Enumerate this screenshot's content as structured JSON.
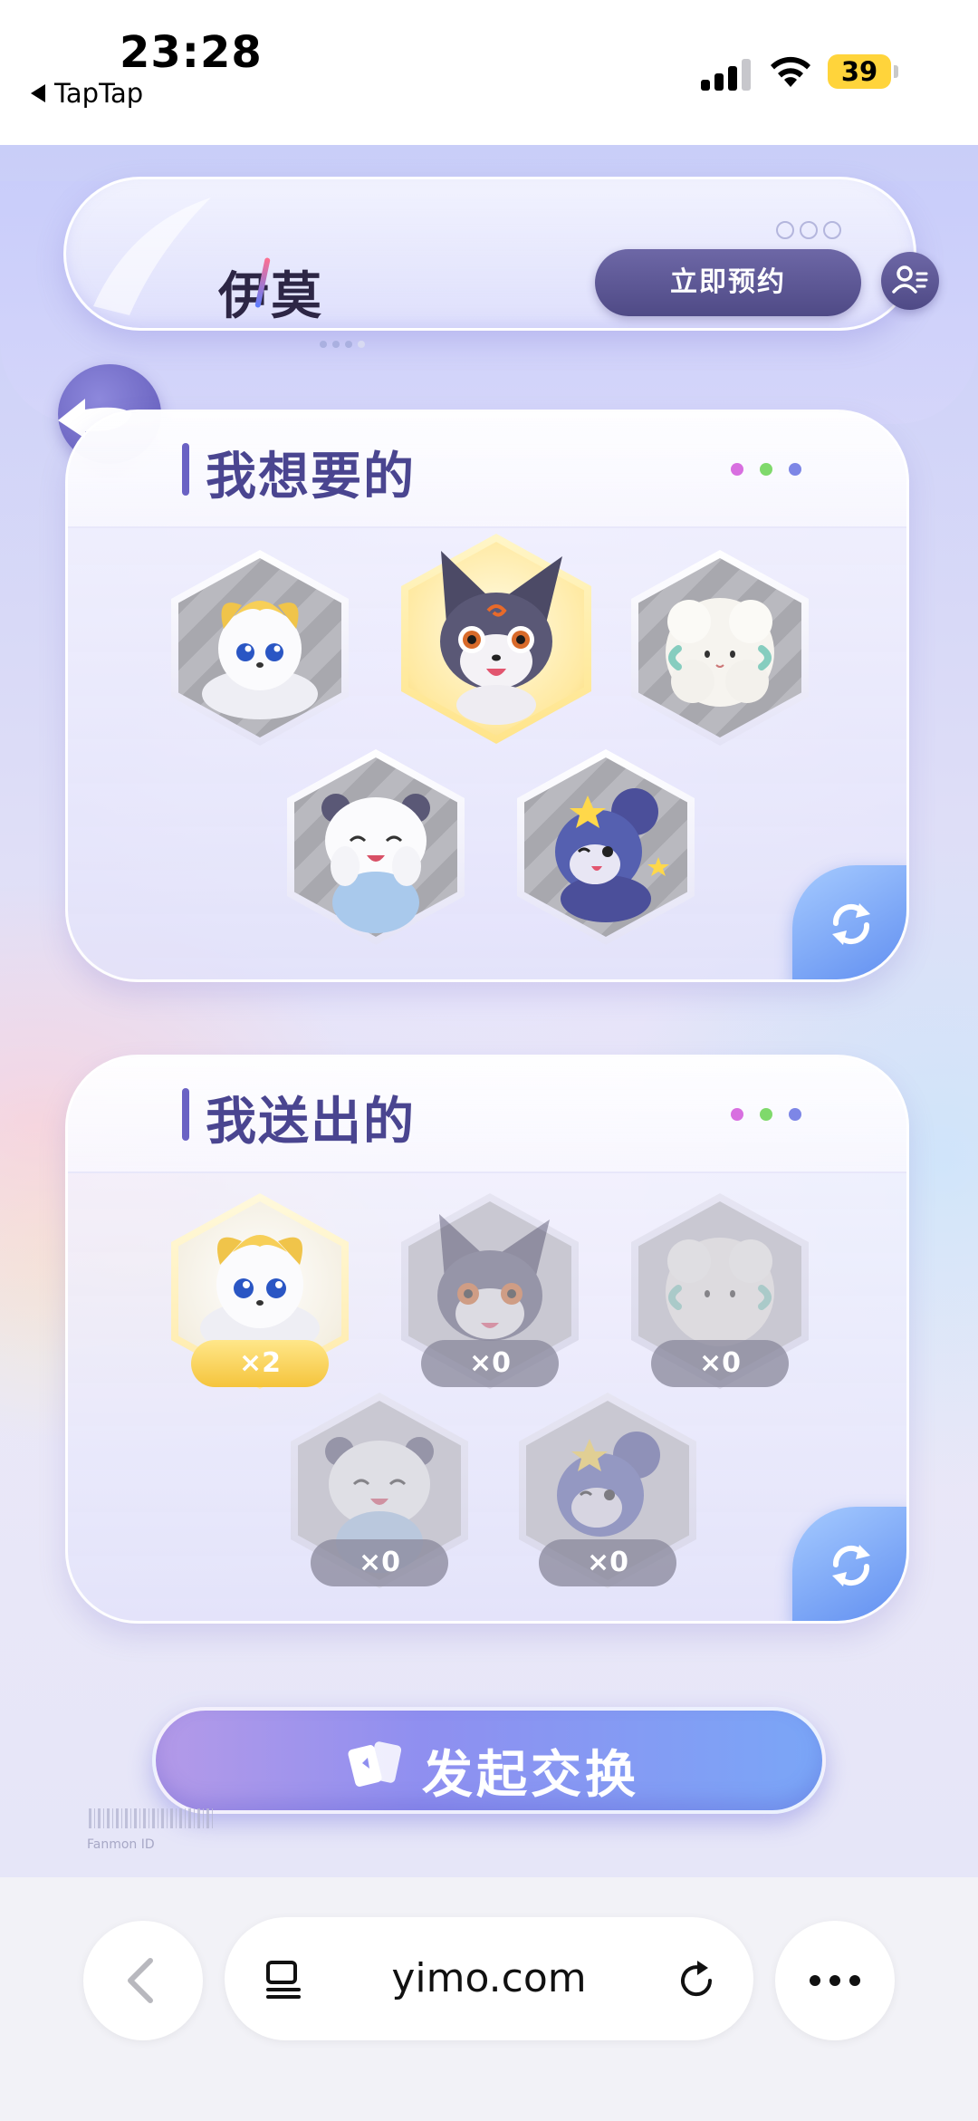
{
  "status_bar": {
    "time": "23:28",
    "back_app": "TapTap",
    "battery": "39"
  },
  "header": {
    "logo": "伊莫",
    "reserve_button": "立即预约"
  },
  "wanted_card": {
    "title": "我想要的",
    "dot_colors": [
      "#d86fe0",
      "#7fd96b",
      "#7d86e6"
    ],
    "pets": [
      {
        "name": "cream-cloud-pet",
        "selected": false
      },
      {
        "name": "dark-fox-pet",
        "selected": true
      },
      {
        "name": "fluffy-sheep-pet",
        "selected": false
      },
      {
        "name": "white-bear-pet",
        "selected": false
      },
      {
        "name": "star-mouse-pet",
        "selected": false
      }
    ]
  },
  "given_card": {
    "title": "我送出的",
    "dot_colors": [
      "#d86fe0",
      "#7fd96b",
      "#7d86e6"
    ],
    "pets": [
      {
        "name": "cream-cloud-pet",
        "count": "×2"
      },
      {
        "name": "dark-fox-pet",
        "count": "×0"
      },
      {
        "name": "fluffy-sheep-pet",
        "count": "×0"
      },
      {
        "name": "white-bear-pet",
        "count": "×0"
      },
      {
        "name": "star-mouse-pet",
        "count": "×0"
      }
    ]
  },
  "action": {
    "exchange_button": "发起交换"
  },
  "footer": {
    "fineprint": "Fanmon ID"
  },
  "browser": {
    "url": "yimo.com"
  },
  "colors": {
    "accent": "#5a53b0",
    "refresh_blue": "#5f8df0",
    "gold": "#f5c43c"
  }
}
